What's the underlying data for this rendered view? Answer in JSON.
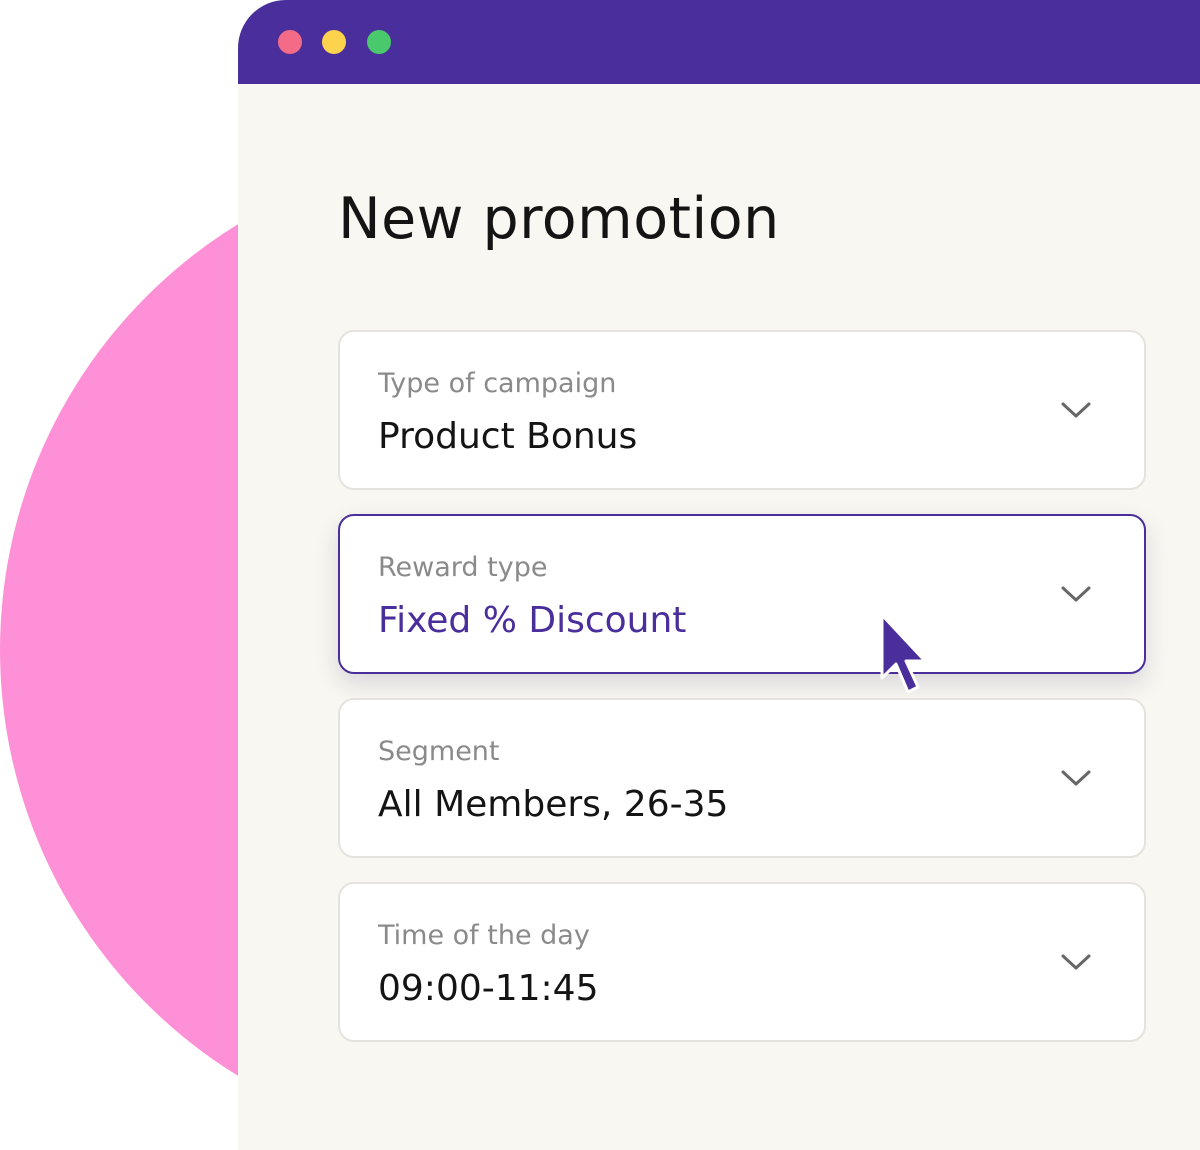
{
  "window": {
    "controls": [
      "close",
      "minimize",
      "maximize"
    ],
    "colors": {
      "titlebar": "#4a2e9b",
      "close": "#f36b86",
      "minimize": "#fdd34e",
      "maximize": "#49c96c",
      "background": "#f8f7f1",
      "blob": "#fd90d7"
    }
  },
  "page": {
    "title": "New promotion"
  },
  "form": {
    "fields": [
      {
        "label": "Type of campaign",
        "value": "Product Bonus",
        "icon": "chevron-down-icon",
        "active": false
      },
      {
        "label": "Reward type",
        "value": "Fixed % Discount",
        "icon": "chevron-down-icon",
        "active": true
      },
      {
        "label": "Segment",
        "value": "All Members, 26-35",
        "icon": "chevron-down-icon",
        "active": false
      },
      {
        "label": "Time of the day",
        "value": "09:00-11:45",
        "icon": "chevron-down-icon",
        "active": false
      }
    ],
    "accent_color": "#4a2e9b"
  },
  "cursor": {
    "icon": "pointer-cursor-icon",
    "color": "#4a2e9b"
  }
}
